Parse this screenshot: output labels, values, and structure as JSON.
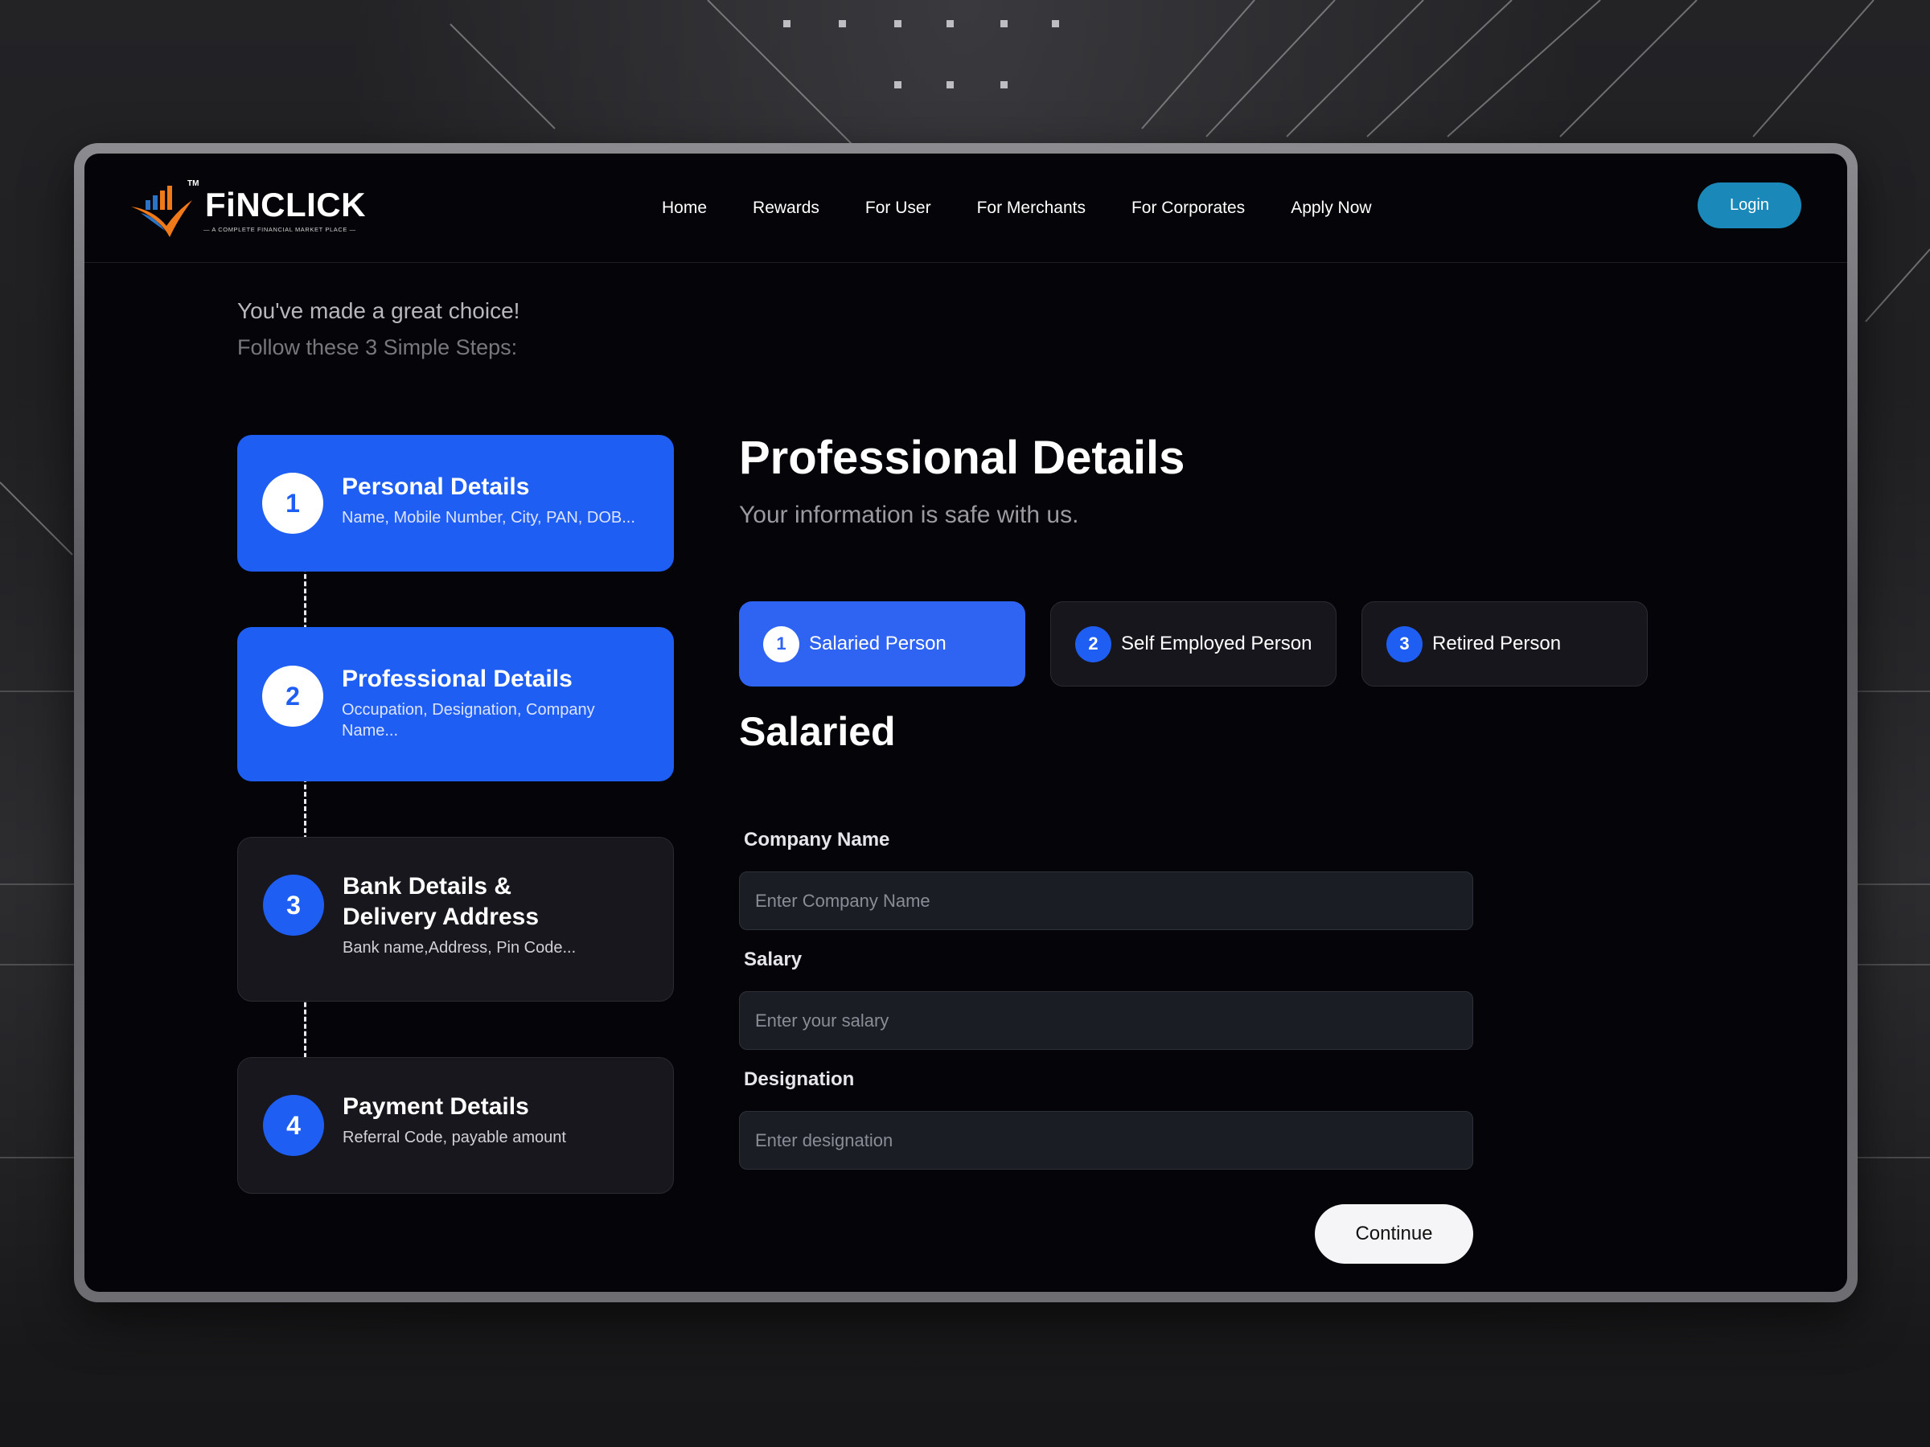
{
  "brand": {
    "name": "FiNCLICK",
    "trademark": "TM",
    "tagline": "— A COMPLETE FINANCIAL MARKET PLACE —",
    "accent_blue": "#1f5ef3",
    "login_blue": "#1a88b8",
    "logo_orange": "#f07a1a"
  },
  "nav": {
    "links": [
      "Home",
      "Rewards",
      "For User",
      "For Merchants",
      "For Corporates",
      "Apply Now"
    ],
    "login_label": "Login"
  },
  "intro": {
    "headline": "You've made a great choice!",
    "subline": "Follow these 3 Simple Steps:"
  },
  "steps": [
    {
      "number": "1",
      "title": "Personal Details",
      "description": "Name, Mobile Number, City, PAN, DOB...",
      "state": "active"
    },
    {
      "number": "2",
      "title": "Professional Details",
      "description": "Occupation, Designation, Company Name...",
      "state": "active"
    },
    {
      "number": "3",
      "title": "Bank Details & Delivery Address",
      "description": "Bank name,Address, Pin Code...",
      "state": "inactive"
    },
    {
      "number": "4",
      "title": "Payment Details",
      "description": "Referral Code, payable amount",
      "state": "inactive"
    }
  ],
  "form": {
    "title": "Professional Details",
    "subtitle": "Your information is safe with us.",
    "employment_types": [
      {
        "number": "1",
        "label": "Salaried Person",
        "selected": true
      },
      {
        "number": "2",
        "label": "Self Employed Person",
        "selected": false
      },
      {
        "number": "3",
        "label": "Retired Person",
        "selected": false
      }
    ],
    "section_title": "Salaried",
    "fields": {
      "company": {
        "label": "Company Name",
        "placeholder": "Enter Company Name",
        "value": ""
      },
      "salary": {
        "label": "Salary",
        "placeholder": "Enter your salary",
        "value": ""
      },
      "designation": {
        "label": "Designation",
        "placeholder": "Enter designation",
        "value": ""
      }
    },
    "continue_label": "Continue"
  }
}
